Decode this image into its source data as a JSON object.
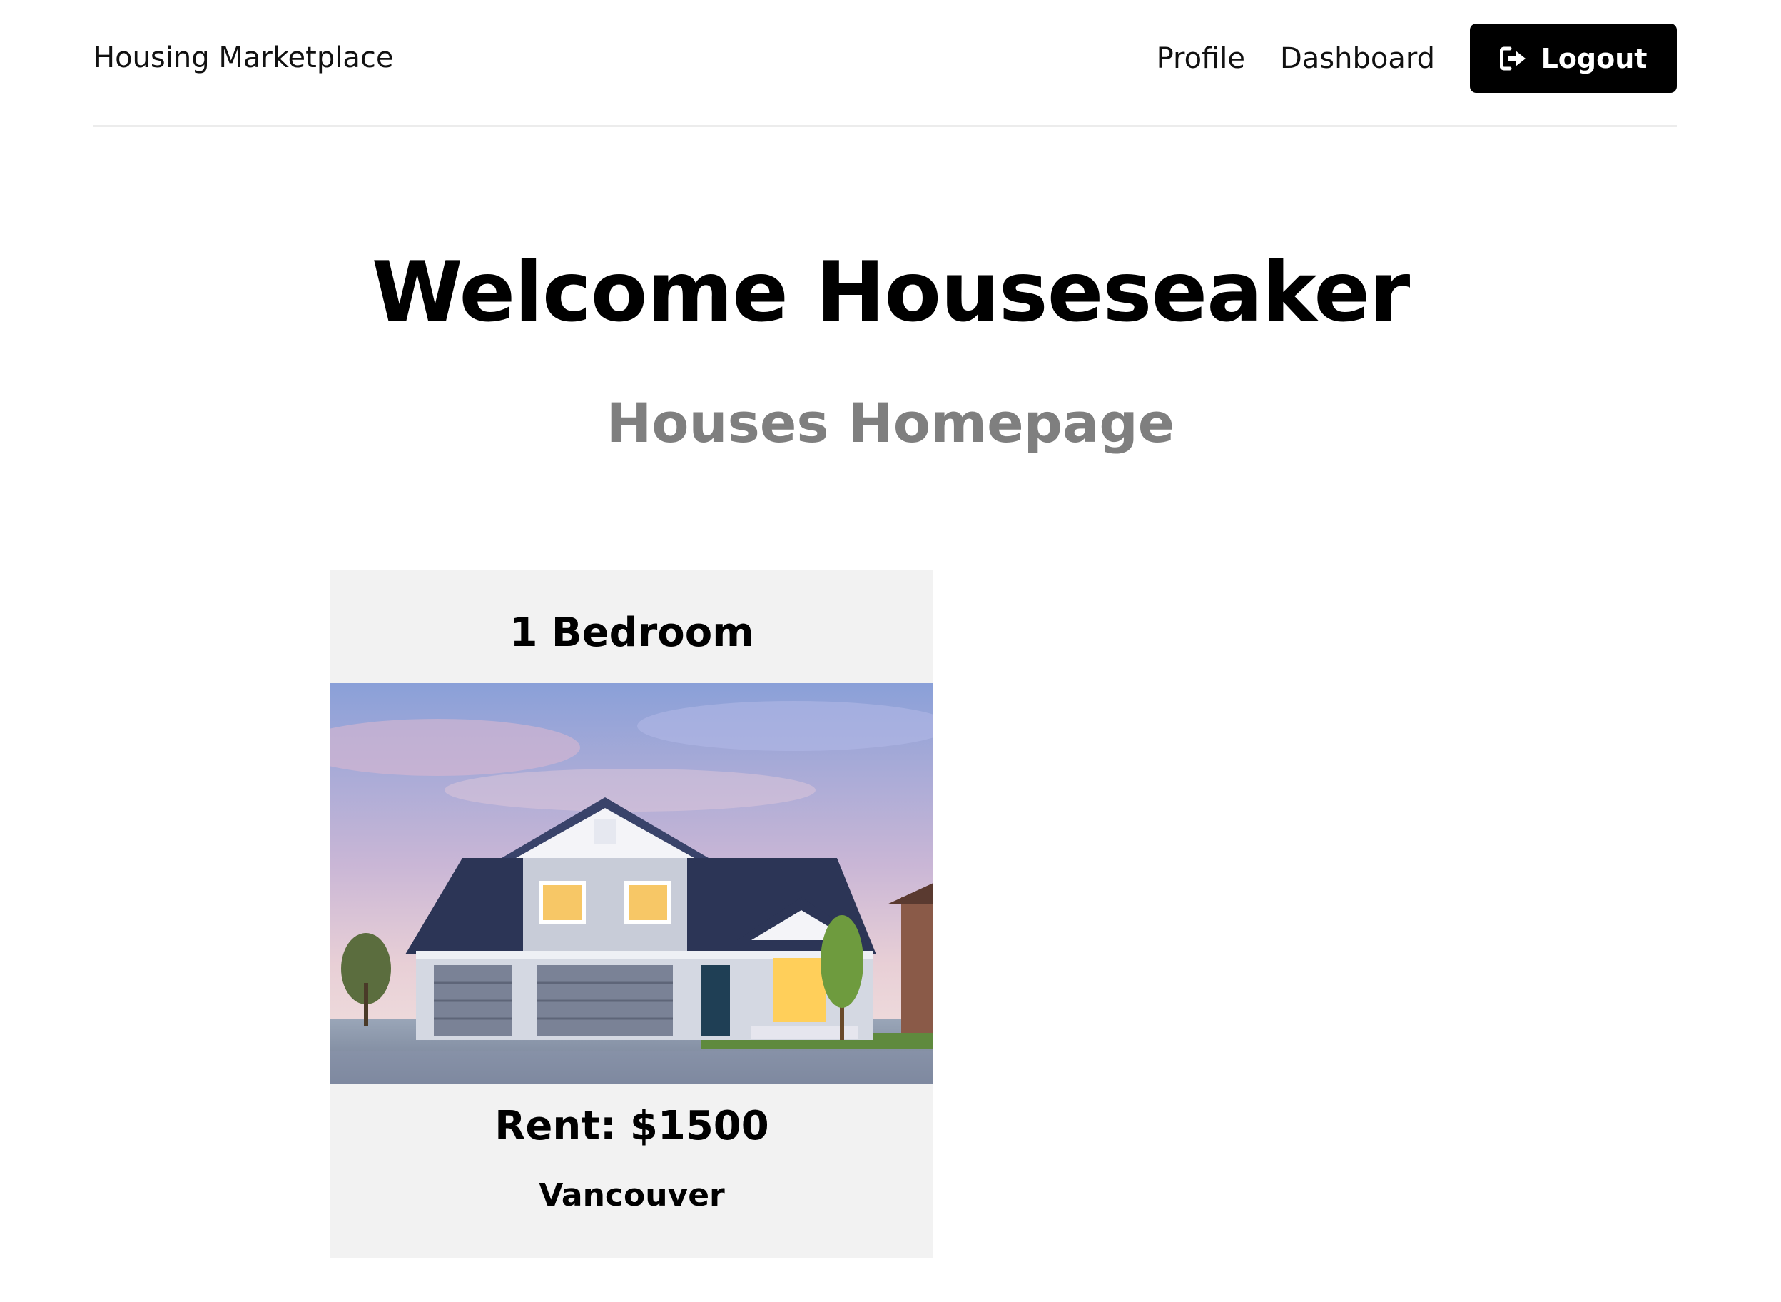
{
  "navbar": {
    "brand": "Housing Marketplace",
    "links": [
      {
        "label": "Profile"
      },
      {
        "label": "Dashboard"
      }
    ],
    "logout_label": "Logout",
    "logout_icon": "sign-out-icon"
  },
  "hero": {
    "title": "Welcome Houseseaker",
    "subtitle": "Houses Homepage"
  },
  "listings": [
    {
      "title": "1 Bedroom",
      "image": "house-photo",
      "rent": "Rent: $1500",
      "city": "Vancouver"
    }
  ],
  "colors": {
    "accent": "#000000",
    "subtitle": "#7f7f7f",
    "card_bg": "#f2f2f2",
    "divider": "#ececec"
  }
}
